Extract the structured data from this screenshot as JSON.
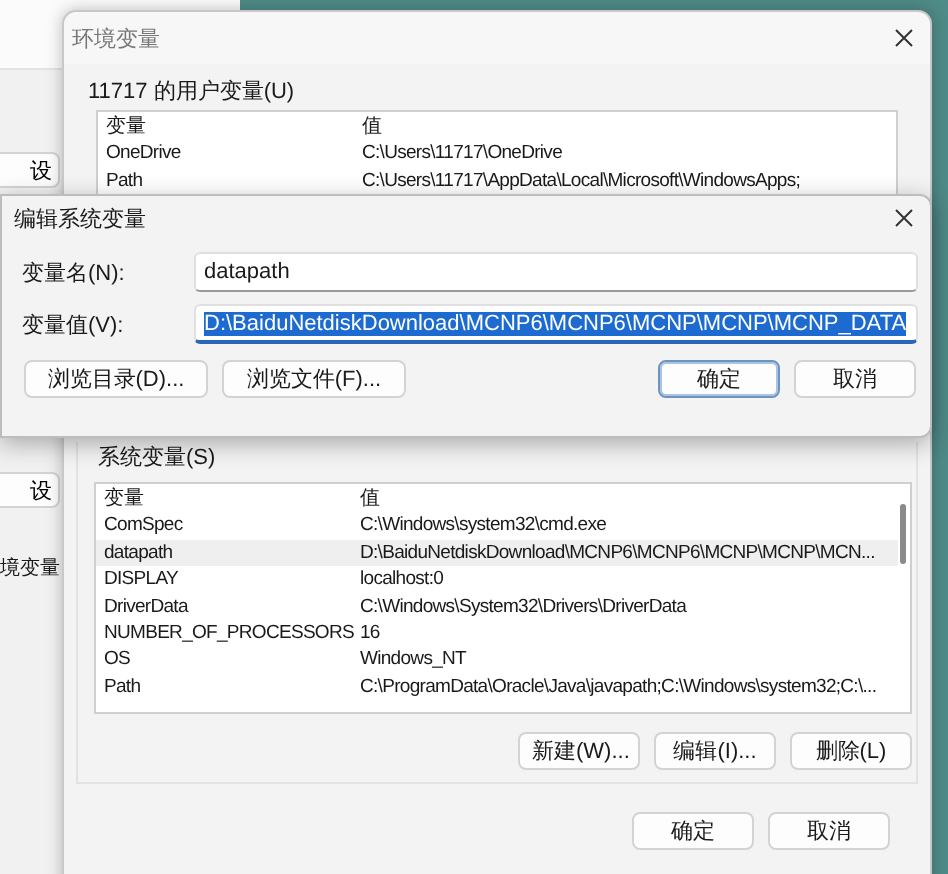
{
  "background_window": {
    "buttons": [
      "设",
      "设"
    ],
    "label": "境变量"
  },
  "env_dialog": {
    "title": "环境变量",
    "user_vars": {
      "label": "11717 的用户变量(U)",
      "columns": [
        "变量",
        "值"
      ],
      "rows": [
        {
          "name": "OneDrive",
          "value": "C:\\Users\\11717\\OneDrive",
          "selected": false
        },
        {
          "name": "Path",
          "value": "C:\\Users\\11717\\AppData\\Local\\Microsoft\\WindowsApps;",
          "selected": false
        }
      ]
    },
    "system_vars": {
      "label": "系统变量(S)",
      "columns": [
        "变量",
        "值"
      ],
      "rows": [
        {
          "name": "ComSpec",
          "value": "C:\\Windows\\system32\\cmd.exe",
          "selected": false
        },
        {
          "name": "datapath",
          "value": "D:\\BaiduNetdiskDownload\\MCNP6\\MCNP6\\MCNP\\MCNP\\MCN...",
          "selected": true
        },
        {
          "name": "DISPLAY",
          "value": "localhost:0",
          "selected": false
        },
        {
          "name": "DriverData",
          "value": "C:\\Windows\\System32\\Drivers\\DriverData",
          "selected": false
        },
        {
          "name": "NUMBER_OF_PROCESSORS",
          "value": "16",
          "selected": false
        },
        {
          "name": "OS",
          "value": "Windows_NT",
          "selected": false
        },
        {
          "name": "Path",
          "value": "C:\\ProgramData\\Oracle\\Java\\javapath;C:\\Windows\\system32;C:\\...",
          "selected": false
        }
      ],
      "buttons": [
        "新建(W)...",
        "编辑(I)...",
        "删除(L)"
      ]
    },
    "buttons": [
      {
        "label": "确定",
        "default": false
      },
      {
        "label": "取消",
        "default": false
      }
    ]
  },
  "edit_dialog": {
    "title": "编辑系统变量",
    "fields": [
      {
        "label": "变量名(N):",
        "value": "datapath",
        "selected": false
      },
      {
        "label": "变量值(V):",
        "value": "D:\\BaiduNetdiskDownload\\MCNP6\\MCNP6\\MCNP\\MCNP\\MCNP_DATA",
        "selected": true
      }
    ],
    "browse_buttons": [
      "浏览目录(D)...",
      "浏览文件(F)..."
    ],
    "buttons": [
      {
        "label": "确定",
        "default": true
      },
      {
        "label": "取消",
        "default": false
      }
    ]
  }
}
